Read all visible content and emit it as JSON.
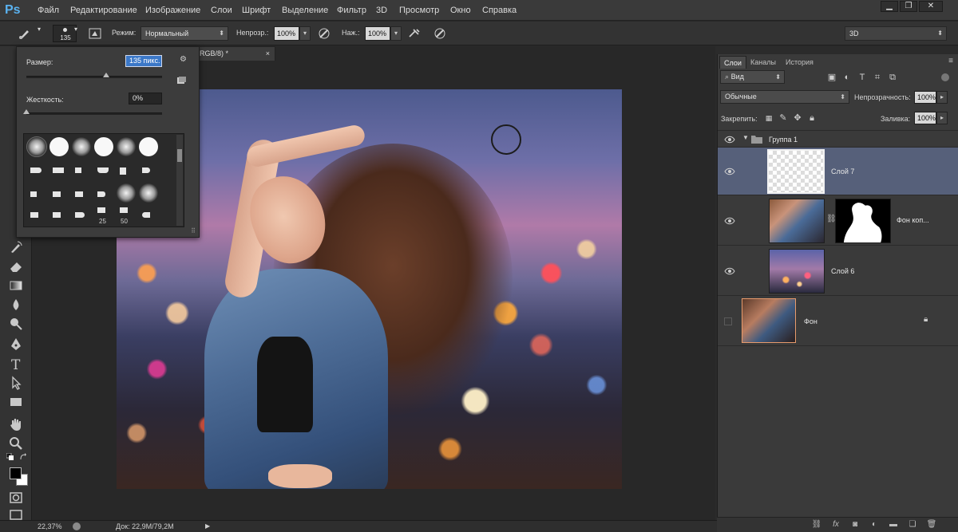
{
  "app": {
    "logo": "Ps"
  },
  "menu": [
    "Файл",
    "Редактирование",
    "Изображение",
    "Слои",
    "Шрифт",
    "Выделение",
    "Фильтр",
    "3D",
    "Просмотр",
    "Окно",
    "Справка"
  ],
  "window_controls": {
    "minimize": "▁",
    "restore": "❐",
    "close": "✕"
  },
  "options": {
    "brush_size": "135",
    "mode_label": "Режим:",
    "mode_value": "Нормальный",
    "opacity_label": "Непрозр.:",
    "opacity_value": "100%",
    "flow_label": "Наж.:",
    "flow_value": "100%",
    "workspace_value": "3D"
  },
  "brush_popup": {
    "size_label": "Размер:",
    "size_value": "135 пикс.",
    "hardness_label": "Жесткость:",
    "hardness_value": "0%",
    "size_slider_fraction": 0.59,
    "hardness_slider_fraction": 0.0,
    "tip_numbers": [
      "25",
      "50"
    ]
  },
  "document": {
    "tab_title": "RGB/8) *",
    "tab_close": "×"
  },
  "layers_panel": {
    "tabs": [
      "Слои",
      "Каналы",
      "История"
    ],
    "filter_value": "Вид",
    "blend_mode": "Обычные",
    "opacity_label": "Непрозрачность:",
    "opacity_value": "100%",
    "lock_label": "Закрепить:",
    "fill_label": "Заливка:",
    "fill_value": "100%",
    "group_name": "Группа 1",
    "layers": [
      {
        "name": "Слой 7",
        "selected": true,
        "visible": true
      },
      {
        "name": "Фон коп...",
        "selected": false,
        "visible": true
      },
      {
        "name": "Слой 6",
        "selected": false,
        "visible": true
      },
      {
        "name": "Фон",
        "selected": false,
        "visible": false
      }
    ]
  },
  "status": {
    "zoom": "22,37%",
    "doc_info": "Док: 22,9M/79,2M"
  },
  "colors": {
    "accent": "#5ab2f0",
    "selected_layer": "#56607a",
    "panel": "#3a3a3a"
  }
}
